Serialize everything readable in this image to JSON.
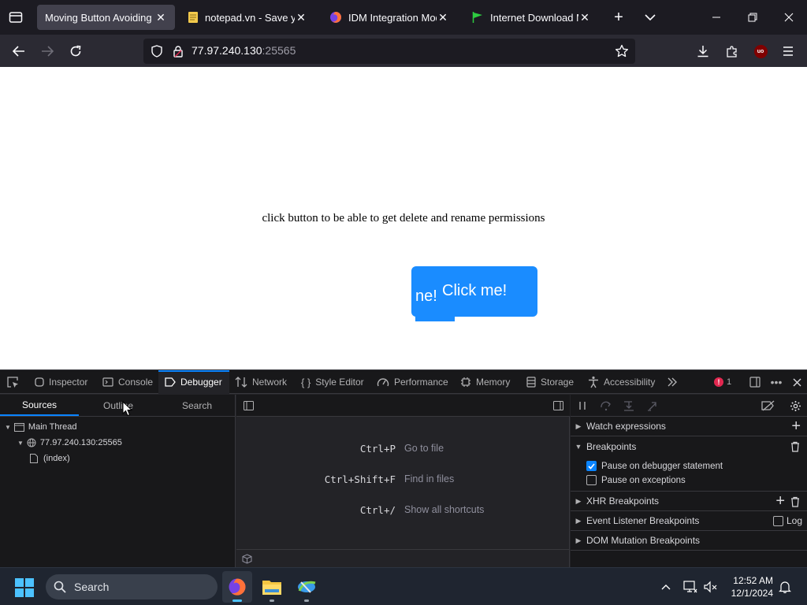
{
  "browser": {
    "tabs": [
      {
        "title": "Moving Button Avoiding M",
        "icon": "none",
        "active": true
      },
      {
        "title": "notepad.vn - Save your",
        "icon": "notepad-icon",
        "active": false
      },
      {
        "title": "IDM Integration Module",
        "icon": "firefox-icon",
        "active": false
      },
      {
        "title": "Internet Download Mana",
        "icon": "flag-icon",
        "active": false
      }
    ],
    "url_host": "77.97.240.130",
    "url_port": ":25565",
    "extension_badge": "uo"
  },
  "page": {
    "instruction_text": "click button to be able to get delete and rename permissions",
    "button_label": "Click me!",
    "button_ghost_text": "ne!",
    "button_color": "#1a8cff"
  },
  "devtools": {
    "tabs": [
      "Inspector",
      "Console",
      "Debugger",
      "Network",
      "Style Editor",
      "Performance",
      "Memory",
      "Storage",
      "Accessibility"
    ],
    "error_count": "1",
    "sources_tabs": [
      "Sources",
      "Outline",
      "Search"
    ],
    "tree": {
      "thread": "Main Thread",
      "host": "77.97.240.130:25565",
      "file": "(index)"
    },
    "shortcuts": [
      {
        "keys": "Ctrl+P",
        "desc": "Go to file"
      },
      {
        "keys": "Ctrl+Shift+F",
        "desc": "Find in files"
      },
      {
        "keys": "Ctrl+/",
        "desc": "Show all shortcuts"
      }
    ],
    "panels": {
      "watch": "Watch expressions",
      "breakpoints": "Breakpoints",
      "pause_debugger": "Pause on debugger statement",
      "pause_exceptions": "Pause on exceptions",
      "xhr": "XHR Breakpoints",
      "event_listener": "Event Listener Breakpoints",
      "log": "Log",
      "dom_mutation": "DOM Mutation Breakpoints"
    }
  },
  "taskbar": {
    "search_label": "Search",
    "time": "12:52 AM",
    "date": "12/1/2024"
  }
}
